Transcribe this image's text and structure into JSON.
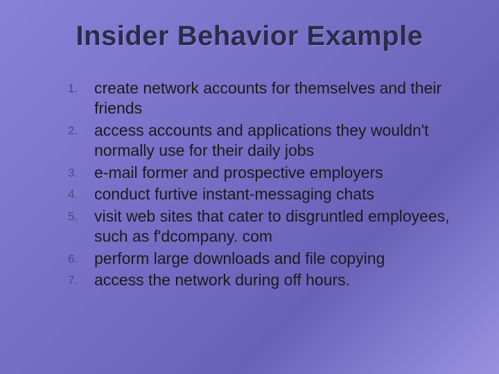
{
  "title": "Insider Behavior Example",
  "items": [
    {
      "num": "1.",
      "text": "create network accounts for themselves and their friends"
    },
    {
      "num": "2.",
      "text": "access accounts and applications they wouldn't normally use for their daily jobs"
    },
    {
      "num": "3.",
      "text": "e-mail former and prospective employers"
    },
    {
      "num": "4.",
      "text": "conduct furtive instant-messaging chats"
    },
    {
      "num": "5.",
      "text": "visit web sites that cater to disgruntled employees, such as f'dcompany. com"
    },
    {
      "num": "6.",
      "text": "perform large downloads and file copying"
    },
    {
      "num": "7.",
      "text": "access the network during off hours."
    }
  ]
}
